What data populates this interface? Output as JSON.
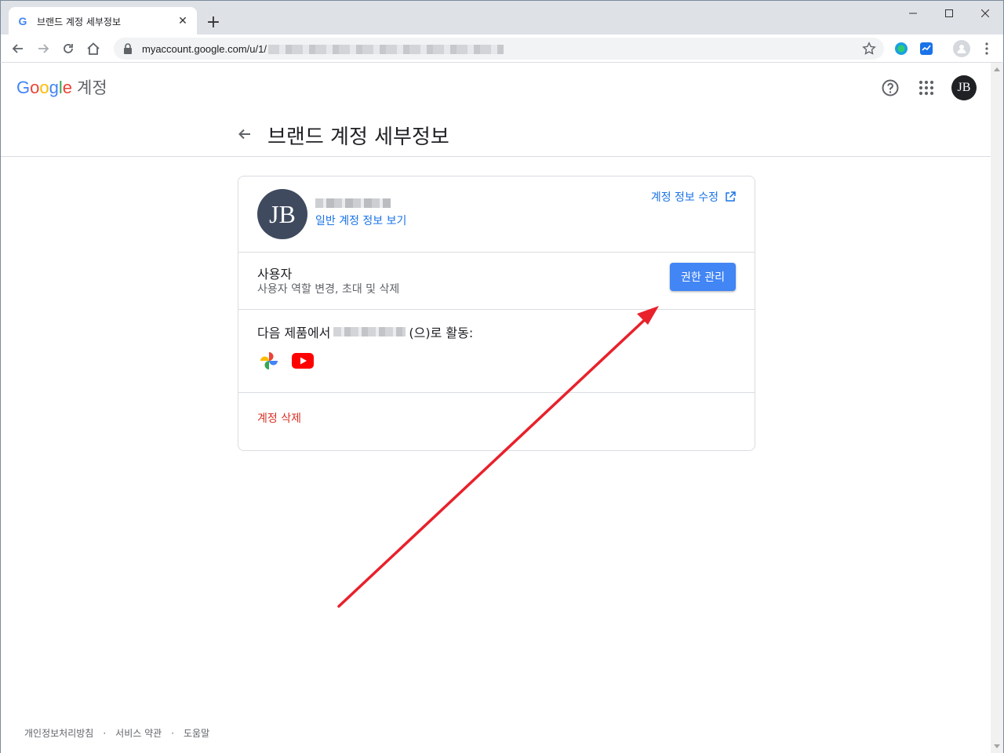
{
  "browser": {
    "tab_title": "브랜드 계정 세부정보",
    "tab_favicon": "G",
    "new_tab_label": "+",
    "close_tab_label": "✕",
    "url_visible": "myaccount.google.com/u/1/"
  },
  "header": {
    "logo_letters": [
      "G",
      "o",
      "o",
      "g",
      "l",
      "e"
    ],
    "logo_suffix": "계정",
    "avatar_initials": "JB"
  },
  "page": {
    "title": "브랜드 계정 세부정보"
  },
  "account_card": {
    "avatar_initials": "JB",
    "view_account_link": "일반 계정 정보 보기",
    "edit_account_link": "계정 정보 수정"
  },
  "users_section": {
    "title": "사용자",
    "description": "사용자 역할 변경, 초대 및 삭제",
    "manage_button": "권한 관리"
  },
  "products_section": {
    "prefix": "다음 제품에서",
    "suffix": "(으)로 활동:",
    "products": [
      "google-photos-icon",
      "youtube-icon"
    ]
  },
  "delete_section": {
    "delete_link": "계정 삭제"
  },
  "footer": {
    "privacy": "개인정보처리방침",
    "terms": "서비스 약관",
    "help": "도움말",
    "separator": "·"
  },
  "colors": {
    "accent": "#4285f4",
    "link": "#1a73e8",
    "danger": "#d93025",
    "annotation_arrow": "#e8212b"
  }
}
